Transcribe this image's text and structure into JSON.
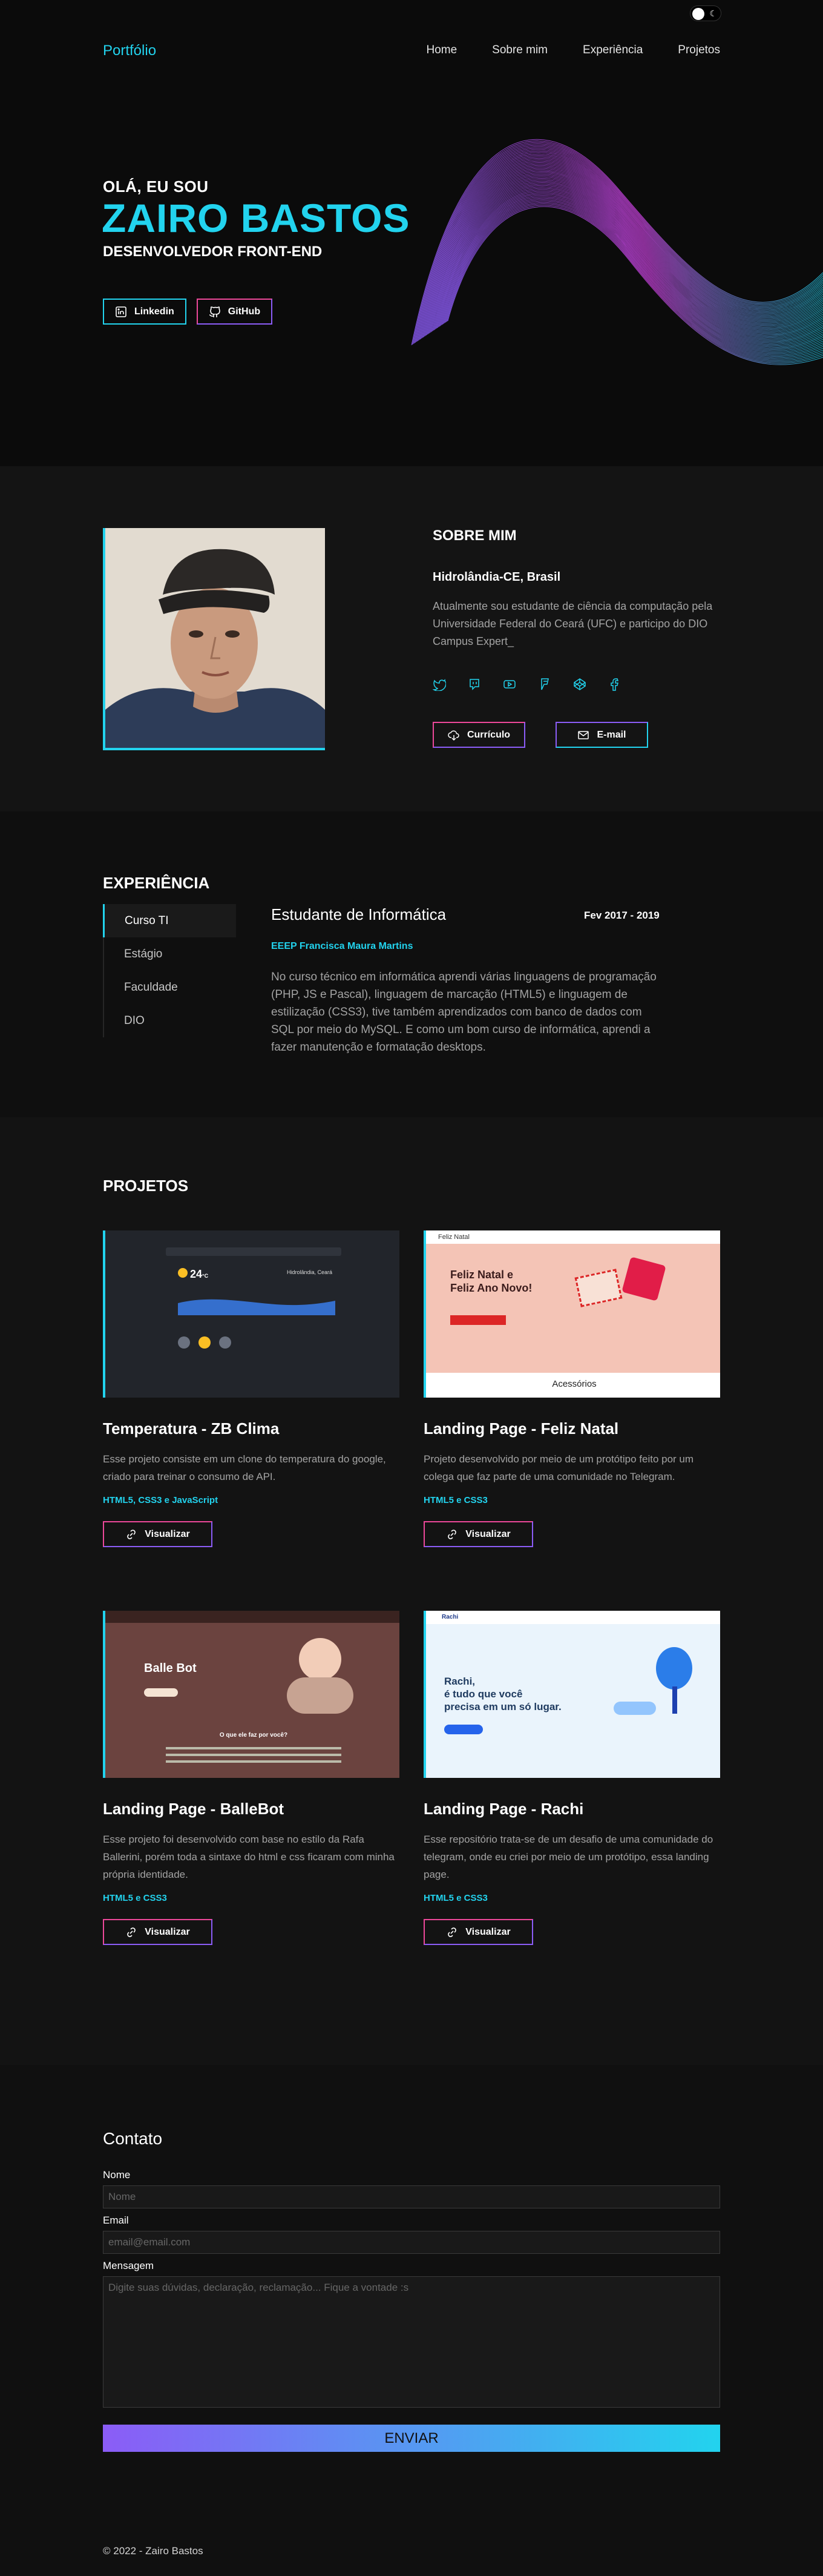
{
  "nav": {
    "brand": "Portfólio",
    "items": [
      "Home",
      "Sobre mim",
      "Experiência",
      "Projetos"
    ]
  },
  "hero": {
    "greeting": "OLÁ, EU SOU",
    "name": "ZAIRO BASTOS",
    "role": "DESENVOLVEDOR FRONT-END",
    "linkedin_label": "Linkedin",
    "github_label": "GitHub"
  },
  "about": {
    "title": "SOBRE MIM",
    "location": "Hidrolândia-CE, Brasil",
    "text": "Atualmente sou estudante de ciência da computação pela Universidade Federal do Ceará (UFC) e participo do DIO Campus Expert_",
    "socials": [
      "twitter-icon",
      "discord-icon",
      "youtube-icon",
      "foursquare-icon",
      "codepen-icon",
      "facebook-icon"
    ],
    "resume_label": "Currículo",
    "email_label": "E-mail"
  },
  "experience": {
    "title": "EXPERIÊNCIA",
    "tabs": [
      "Curso TI",
      "Estágio",
      "Faculdade",
      "DIO"
    ],
    "active": {
      "role": "Estudante de Informática",
      "date": "Fev 2017 - 2019",
      "org": "EEEP Francisca Maura Martins",
      "description": "No curso técnico em informática aprendi várias linguagens de programação (PHP, JS e Pascal), linguagem de marcação (HTML5) e linguagem de estilização (CSS3), tive também aprendizados com banco de dados com SQL por meio do MySQL. E como um bom curso de informática, aprendi a fazer manutenção e formatação desktops."
    }
  },
  "projects": {
    "title": "PROJETOS",
    "button_label": "Visualizar",
    "items": [
      {
        "title": "Temperatura - ZB Clima",
        "description": "Esse projeto consiste em um clone do temperatura do google, criado para treinar o consumo de API.",
        "tech": "HTML5, CSS3 e JavaScript",
        "shot": {
          "city": "Hidrolândia, Ceará",
          "temp": "24",
          "unit": "°C"
        }
      },
      {
        "title": "Landing Page - Feliz Natal",
        "description": "Projeto desenvolvido por meio de um protótipo feito por um colega que faz parte de uma comunidade no Telegram.",
        "tech": "HTML5 e CSS3",
        "shot": {
          "logo": "Feliz Natal",
          "headline1": "Feliz Natal e",
          "headline2": "Feliz Ano Novo!",
          "footer": "Acessórios"
        }
      },
      {
        "title": "Landing Page - BalleBot",
        "description": "Esse projeto foi desenvolvido com base no estilo da Rafa Ballerini, porém toda a sintaxe do html e css ficaram com minha própria identidade.",
        "tech": "HTML5 e CSS3",
        "shot": {
          "headline": "Balle Bot",
          "question": "O que ele faz por você?"
        }
      },
      {
        "title": "Landing Page - Rachi",
        "description": "Esse repositório trata-se de um desafio de uma comunidade do telegram, onde eu criei por meio de um protótipo, essa landing page.",
        "tech": "HTML5 e CSS3",
        "shot": {
          "logo": "Rachi",
          "headline1": "Rachi,",
          "headline2": "é tudo que você",
          "headline3": "precisa em um só lugar."
        }
      }
    ]
  },
  "contact": {
    "title": "Contato",
    "name_label": "Nome",
    "name_placeholder": "Nome",
    "email_label": "Email",
    "email_placeholder": "email@email.com",
    "message_label": "Mensagem",
    "message_placeholder": "Digite suas dúvidas, declaração, reclamação... Fique a vontade :s",
    "send_label": "ENVIAR"
  },
  "footer": {
    "text": "© 2022 - Zairo Bastos"
  },
  "colors": {
    "accent": "#22d3ee",
    "purple": "#8b5cf6",
    "pink": "#ec4899",
    "bg": "#121212"
  }
}
